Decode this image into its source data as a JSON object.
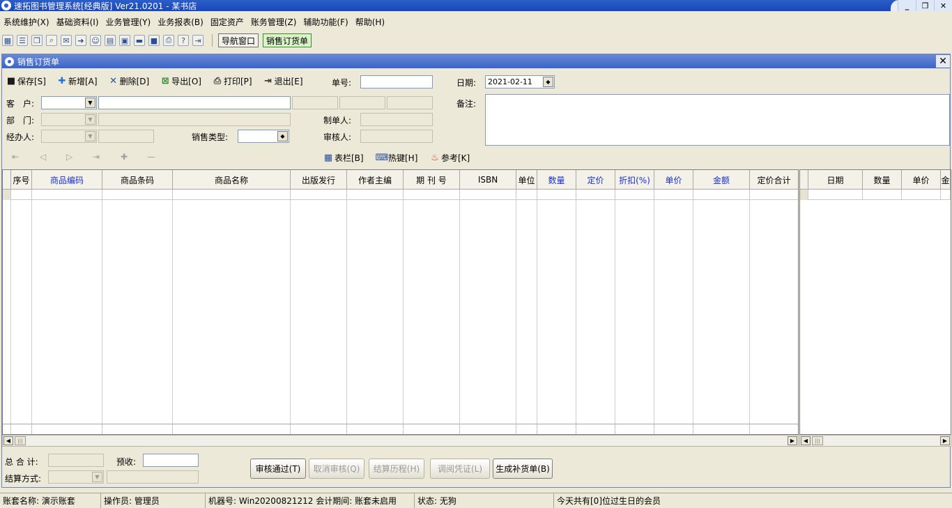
{
  "window": {
    "title": "速拓图书管理系统[经典版] Ver21.0201  -  某书店"
  },
  "menu": [
    "系统维护(X)",
    "基础资料(I)",
    "业务管理(Y)",
    "业务报表(B)",
    "固定资产",
    "账务管理(Z)",
    "辅助功能(F)",
    "帮助(H)"
  ],
  "toolbar": {
    "nav_label": "导航窗口",
    "order_label": "销售订货单",
    "icons": [
      "grid-icon",
      "list-icon",
      "window-icon",
      "search-icon",
      "chat-icon",
      "arrow-icon",
      "user-icon",
      "form-icon",
      "folder-icon",
      "card-icon",
      "save-icon",
      "print-icon",
      "help-icon",
      "exit-icon"
    ]
  },
  "child": {
    "title": "销售订货单"
  },
  "actions": {
    "save": "保存[S]",
    "add": "新增[A]",
    "delete": "删除[D]",
    "export": "导出[O]",
    "print": "打印[P]",
    "exit": "退出[E]"
  },
  "form": {
    "order_no_label": "单号:",
    "order_no": "",
    "date_label": "日期:",
    "date": "2021-02-11",
    "customer_label": "客　户:",
    "dept_label": "部　门:",
    "handler_label": "经办人:",
    "sales_type_label": "销售类型:",
    "maker_label": "制单人:",
    "auditor_label": "审核人:",
    "remark_label": "备注:"
  },
  "subbar": {
    "columns": "表栏[B]",
    "hotkey": "热键[H]",
    "reference": "参考[K]"
  },
  "grid": {
    "headers": [
      "",
      "序号",
      "商品编码",
      "商品条码",
      "商品名称",
      "出版发行",
      "作者主编",
      "期 刊 号",
      "ISBN",
      "单位",
      "数量",
      "定价",
      "折扣(%)",
      "单价",
      "金额",
      "定价合计"
    ],
    "blue": [
      2,
      10,
      11,
      12,
      13,
      14
    ]
  },
  "grid2": {
    "headers": [
      "",
      "日期",
      "数量",
      "单价",
      "金"
    ]
  },
  "bottom": {
    "total_label": "总 合 计:",
    "prepay_label": "预收:",
    "settle_label": "结算方式:",
    "approve": "审核通过(T)",
    "cancel_approve": "取消审核(Q)",
    "settle_history": "结算历程(H)",
    "voucher": "调阅凭证(L)",
    "replenish": "生成补货单(B)"
  },
  "status": {
    "account": "账套名称: 演示账套",
    "operator": "操作员: 管理员",
    "machine": "机器号: Win20200821212 会计期间: 账套未启用",
    "state": "状态: 无狗",
    "birthday": "今天共有[0]位过生日的会员"
  }
}
